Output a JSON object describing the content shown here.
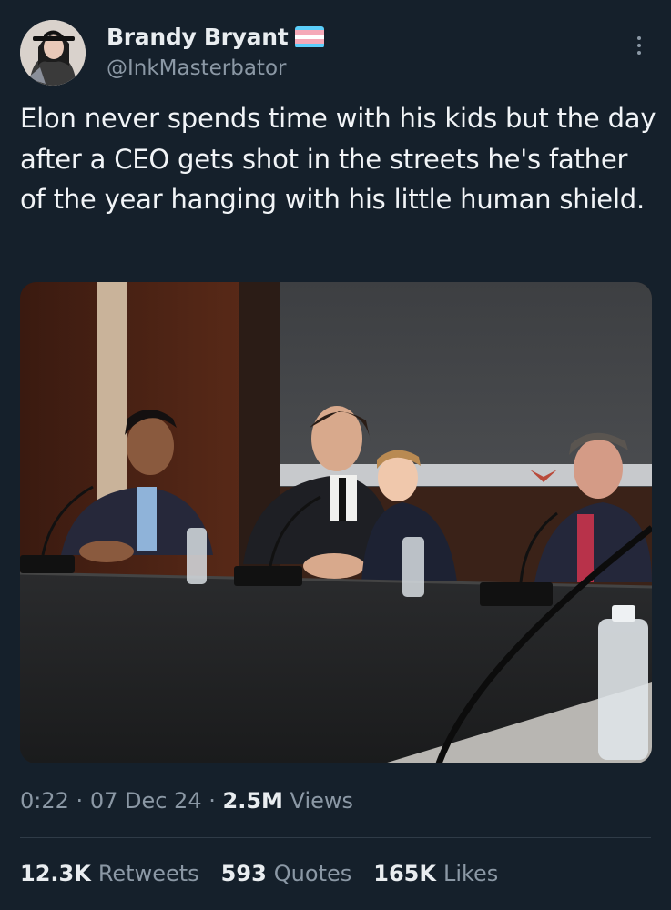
{
  "author": {
    "display_name": "Brandy Bryant",
    "handle": "@InkMasterbator",
    "badge_icon": "trans-pride-flag-icon",
    "flag_colors": [
      "#5bcefa",
      "#f5a9b8",
      "#ffffff",
      "#f5a9b8",
      "#5bcefa"
    ]
  },
  "tweet": {
    "text": "Elon never spends time with his kids but the day after a CEO gets shot in the streets he's father of the year hanging with his little human shield."
  },
  "meta": {
    "time": "0:22",
    "date": "07 Dec 24",
    "views_count": "2.5M",
    "views_label": "Views"
  },
  "stats": {
    "retweets_count": "12.3K",
    "retweets_label": "Retweets",
    "quotes_count": "593",
    "quotes_label": "Quotes",
    "likes_count": "165K",
    "likes_label": "Likes"
  },
  "colors": {
    "background": "#15202b",
    "primary_text": "#f1f4f7",
    "secondary_text": "#8b98a5",
    "divider": "#2f3b47"
  }
}
